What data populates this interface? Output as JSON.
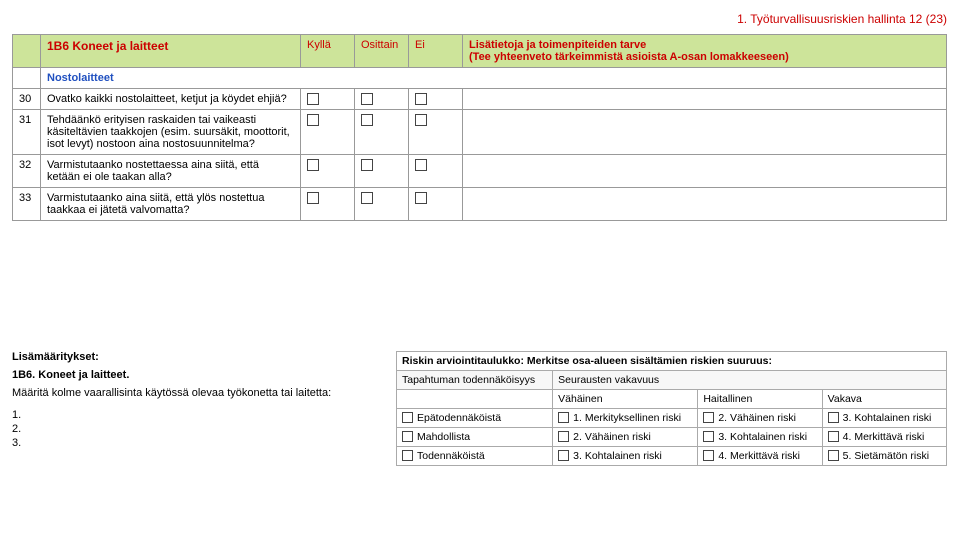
{
  "page_header": "1. Työturvallisuusriskien hallinta 12 (23)",
  "header": {
    "section_code": "1B6",
    "section_title": "Koneet ja laitteet",
    "col_yes": "Kyllä",
    "col_partial": "Osittain",
    "col_no": "Ei",
    "info_line1": "Lisätietoja ja toimenpiteiden tarve",
    "info_line2": "(Tee yhteenveto tärkeimmistä asioista A-osan lomakkeeseen)"
  },
  "section_sub": "Nostolaitteet",
  "rows": [
    {
      "n": "30",
      "q": "Ovatko kaikki nostolaitteet, ketjut ja köydet ehjiä?"
    },
    {
      "n": "31",
      "q": "Tehdäänkö erityisen raskaiden tai vaikeasti käsiteltävien taakkojen (esim. suursäkit, moottorit, isot levyt) nostoon aina nostosuunnitelma?"
    },
    {
      "n": "32",
      "q": "Varmistutaanko nostettaessa aina siitä, että ketään ei ole taakan alla?"
    },
    {
      "n": "33",
      "q": "Varmistutaanko aina siitä, että ylös nostettua taakkaa ei jätetä valvomatta?"
    }
  ],
  "lower": {
    "left_title": "Lisämääritykset:",
    "left_sub": "1B6. Koneet ja laitteet.",
    "left_instr": "Määritä kolme vaarallisinta käytössä olevaa työkonetta tai laitetta:",
    "nums": [
      "1.",
      "2.",
      "3."
    ],
    "risk_title": "Riskin arviointitaulukko: Merkitse osa-alueen sisältämien riskien suuruus:",
    "prob_label": "Tapahtuman todennäköisyys",
    "sev_label": "Seurausten vakavuus",
    "sev_cols": [
      "Vähäinen",
      "Haitallinen",
      "Vakava"
    ],
    "matrix": [
      {
        "prob": "Epätodennäköistä",
        "cells": [
          "1. Merkityksellinen riski",
          "2. Vähäinen riski",
          "3. Kohtalainen riski"
        ]
      },
      {
        "prob": "Mahdollista",
        "cells": [
          "2. Vähäinen riski",
          "3. Kohtalainen riski",
          "4. Merkittävä riski"
        ]
      },
      {
        "prob": "Todennäköistä",
        "cells": [
          "3. Kohtalainen riski",
          "4. Merkittävä riski",
          "5. Sietämätön riski"
        ]
      }
    ]
  }
}
